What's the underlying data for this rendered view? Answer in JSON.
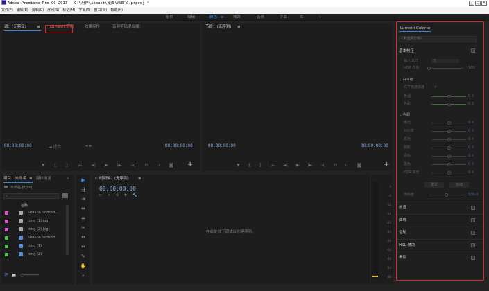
{
  "window": {
    "title": "Adobe Premiere Pro CC 2017 - C:\\用户\\itcast\\桌面\\未命名.prproj *",
    "controls": [
      "_",
      "□",
      "×"
    ]
  },
  "menu": [
    "文件(F)",
    "编辑(E)",
    "剪辑(C)",
    "序列(S)",
    "标记(M)",
    "字幕(T)",
    "窗口(W)",
    "帮助(H)"
  ],
  "workspaces": {
    "items": [
      "组件",
      "编辑",
      "颜色",
      "效果",
      "音频",
      "字幕",
      "库"
    ],
    "active_index": 2,
    "more": "»",
    "active_menu_glyph": "≡"
  },
  "source_panel": {
    "tabs": [
      "源：(无剪辑)",
      "Lumetri 范围",
      "效果控件",
      "音频剪辑混合器："
    ],
    "tab_menu_glyph": "≡",
    "timecode_left": "00:00:00:00",
    "timecode_right": "00:00:00:00",
    "fit_label": "适合",
    "zoom_glyph": "◄ ►"
  },
  "program_panel": {
    "title": "节目：(无序列)",
    "menu_glyph": "≡",
    "timecode_left": "00:00:00:00",
    "timecode_right": "00:00:00:00"
  },
  "project_panel": {
    "tabs": [
      "项目：未命名",
      "媒体浏览",
      "»"
    ],
    "menu_glyph": "≡",
    "project_file": "未命名.prproj",
    "search_placeholder": "",
    "column_header": "名称",
    "items": [
      {
        "name": "5b41667fd8c53...",
        "color": "#e055d0",
        "type": "image"
      },
      {
        "name": "timg (1).jpg",
        "color": "#e055d0",
        "type": "image"
      },
      {
        "name": "timg (2).jpg",
        "color": "#e055d0",
        "type": "image"
      },
      {
        "name": "5b41667fd8c53",
        "color": "#4cc34c",
        "type": "sequence"
      },
      {
        "name": "timg (1)",
        "color": "#4cc34c",
        "type": "sequence"
      },
      {
        "name": "timg (2)",
        "color": "#4cc34c",
        "type": "sequence"
      }
    ]
  },
  "timeline_panel": {
    "title": "时间轴：(无序列)",
    "menu_glyph": "≡",
    "close_glyph": "×",
    "timecode": "00;00;00;00",
    "empty_message": "在此处放下媒体以创建序列。"
  },
  "audio_meter": {
    "ticks": [
      "0",
      "-6",
      "-12",
      "-18",
      "-24",
      "-30",
      "-36",
      "-42",
      "-48",
      "-54",
      "dB"
    ]
  },
  "lumetri": {
    "title": "Lumetri Color",
    "menu_glyph": "≡",
    "clip_select": "(未选择剪辑)",
    "basic_correction": "基本校正",
    "input_lut": {
      "label": "输入 LUT",
      "value": "无"
    },
    "hdr_white": {
      "label": "HDR 白色",
      "value": "100"
    },
    "white_balance": "白平衡",
    "wb_selector": "白平衡选择器",
    "wb_rows": [
      {
        "label": "色温",
        "value": "0.0"
      },
      {
        "label": "色彩",
        "value": "0.0"
      }
    ],
    "tone": "色调",
    "tone_rows": [
      {
        "label": "曝光",
        "value": "0.0"
      },
      {
        "label": "对比度",
        "value": "0.0"
      },
      {
        "label": "高光",
        "value": "0.0"
      },
      {
        "label": "阴影",
        "value": "0.0"
      },
      {
        "label": "白色",
        "value": "0.0"
      },
      {
        "label": "黑色",
        "value": "0.0"
      },
      {
        "label": "HDR 高光",
        "value": "0.0"
      }
    ],
    "reset_label": "重置",
    "auto_label": "自动",
    "saturation": {
      "label": "饱和度",
      "value": "100.0"
    },
    "sections": [
      "创意",
      "曲线",
      "色轮",
      "HSL 辅助",
      "晕影"
    ]
  },
  "colors": {
    "accent": "#2d8ceb",
    "highlight": "#e0242a",
    "panel_bg": "#1d1d1d",
    "app_bg": "#232323"
  }
}
